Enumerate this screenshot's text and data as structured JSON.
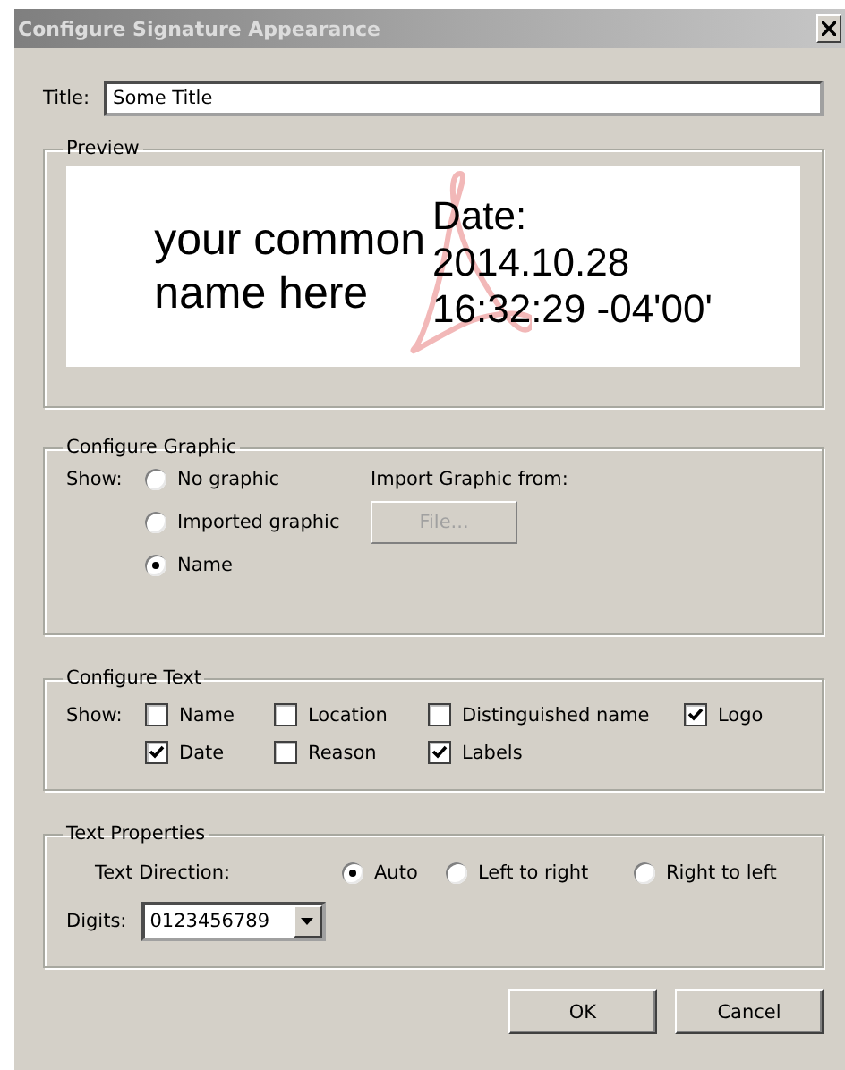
{
  "window": {
    "title": "Configure Signature Appearance"
  },
  "title_field": {
    "label": "Title:",
    "value": "Some Title"
  },
  "preview": {
    "legend": "Preview",
    "name_lines": [
      "your common",
      "name here"
    ],
    "date_lines": [
      "Date:",
      "2014.10.28",
      "16:32:29 -04'00'"
    ]
  },
  "configure_graphic": {
    "legend": "Configure Graphic",
    "show_label": "Show:",
    "options": [
      {
        "label": "No graphic",
        "selected": false
      },
      {
        "label": "Imported graphic",
        "selected": false
      },
      {
        "label": "Name",
        "selected": true
      }
    ],
    "import_label": "Import Graphic from:",
    "file_button": {
      "label": "File...",
      "disabled": true
    }
  },
  "configure_text": {
    "legend": "Configure Text",
    "show_label": "Show:",
    "options": [
      {
        "label": "Name",
        "checked": false
      },
      {
        "label": "Location",
        "checked": false
      },
      {
        "label": "Distinguished name",
        "checked": false
      },
      {
        "label": "Logo",
        "checked": true
      },
      {
        "label": "Date",
        "checked": true
      },
      {
        "label": "Reason",
        "checked": false
      },
      {
        "label": "Labels",
        "checked": true
      }
    ]
  },
  "text_properties": {
    "legend": "Text Properties",
    "direction_label": "Text Direction:",
    "directions": [
      {
        "label": "Auto",
        "selected": true
      },
      {
        "label": "Left to right",
        "selected": false
      },
      {
        "label": "Right to left",
        "selected": false
      }
    ],
    "digits_label": "Digits:",
    "digits_value": "0123456789"
  },
  "buttons": [
    {
      "label": "OK"
    },
    {
      "label": "Cancel"
    }
  ]
}
